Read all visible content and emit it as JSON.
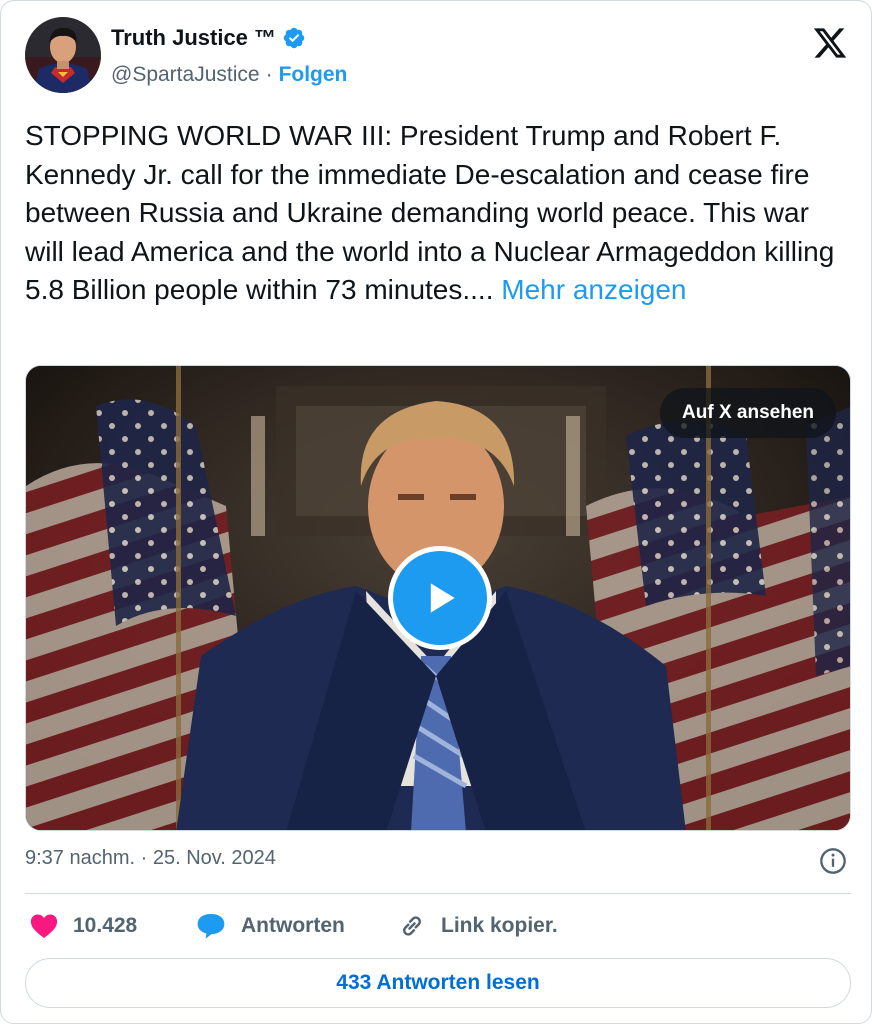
{
  "author": {
    "name": "Truth Justice ™",
    "handle": "@SpartaJustice",
    "separator": "·",
    "follow_label": "Folgen"
  },
  "tweet": {
    "text": "STOPPING WORLD WAR III: President Trump and Robert F. Kennedy Jr. call for the immediate De-escalation and cease fire between Russia and Ukraine demanding world peace. This war will lead America and the world into a Nuclear Armageddon killing 5.8 Billion people within 73 minutes.... ",
    "more_label": "Mehr anzeigen"
  },
  "media": {
    "watch_label": "Auf X ansehen",
    "play_icon": "play-icon"
  },
  "meta": {
    "timestamp": "9:37 nachm. · 25. Nov. 2024",
    "info_icon": "info-icon"
  },
  "actions": {
    "like_count": "10.428",
    "reply_label": "Antworten",
    "link_label": "Link kopier."
  },
  "footer": {
    "read_replies_label": "433 Antworten lesen"
  },
  "colors": {
    "accent": "#1d9bf0",
    "like": "#f91880",
    "secondary_text": "#536471",
    "border": "#cfd9de"
  }
}
